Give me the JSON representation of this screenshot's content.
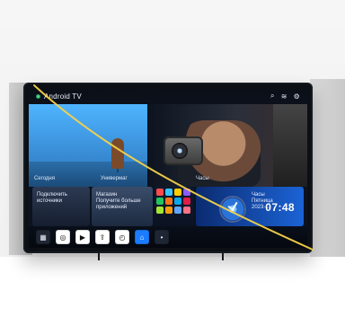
{
  "tv_ui": {
    "top_bar": {
      "brand": "Android TV",
      "icons": {
        "search": "search-icon",
        "wifi": "wifi-icon",
        "settings": "gear-icon"
      }
    },
    "rows": {
      "labels": [
        "Сегодня",
        "Универмаг",
        "Часы"
      ]
    },
    "cards": {
      "c1_text": "Подключить источники",
      "c2_title": "Магазин",
      "c2_sub": "Получите больше приложений",
      "c4_title": "Часы",
      "c4_sub": "Пятница\n2023-...",
      "clock": "07:48"
    },
    "app_grid": {
      "tiles": [
        "#ff4b4b",
        "#36c3ff",
        "#ffcc00",
        "#8b5cf6",
        "#22c55e",
        "#f97316",
        "#0ea5e9",
        "#e11d48",
        "#a3e635",
        "#f59e0b",
        "#60a5fa",
        "#fb7185"
      ]
    },
    "dock": {
      "icons": [
        {
          "name": "grid-icon",
          "glyph": "▦",
          "style": "dark"
        },
        {
          "name": "chrome-icon",
          "glyph": "◎",
          "style": "light"
        },
        {
          "name": "play-icon",
          "glyph": "▶",
          "style": "light"
        },
        {
          "name": "share-icon",
          "glyph": "⇪",
          "style": "light"
        },
        {
          "name": "clock-icon",
          "glyph": "◴",
          "style": "light"
        },
        {
          "name": "home-icon",
          "glyph": "⌂",
          "style": "blue"
        },
        {
          "name": "more-icon",
          "glyph": "•",
          "style": "dark"
        }
      ]
    }
  }
}
